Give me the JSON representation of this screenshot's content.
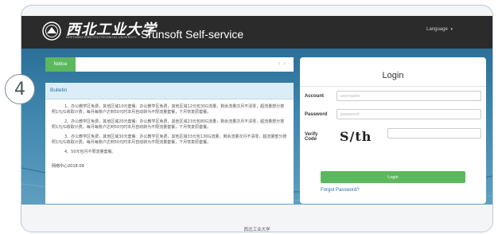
{
  "step_number": "4",
  "header": {
    "logo_cn": "西北工业大学",
    "logo_en": "NORTHWESTERN POLYTECHNICAL UNIVERSITY",
    "app_title": "Srunsoft Self-service",
    "language_label": "Language",
    "language_caret": "▾"
  },
  "notice": {
    "tab_label": "Notice",
    "nav_prev": "‹",
    "nav_next": "›"
  },
  "bulletin": {
    "title": "Bulletin",
    "items": [
      "1、办公教学区免费，其他区域10元套餐：办公教学区免费，其他区域12元包30G流量，剩余流量次月不清零，超流量部分按照1元/G收取计费。每月每账户达到50元时本月自动转为不限流量套餐，下月恢复原套餐。",
      "2、办公教学区免费，其他区域20元套餐：办公教学区免费，其他区域23元包80G流量，剩余流量次月不清零，超流量部分按照1元/G收取计费。每月每账户达到50元时本月自动转为不限流量套餐，下月恢复原套餐。",
      "3、办公教学区免费，其他区域30元套餐：办公教学区免费，其他区域33元包130G流量，剩余流量次月不清零，超流量部分按照1元/G收取计费。每月每账户达到50元时本月自动转为不限流量套餐，下月恢复原套餐。",
      "4、50元包月不限流量套餐。"
    ],
    "signature": "网络中心2018.09"
  },
  "login": {
    "title": "Login",
    "account_label": "Account",
    "account_placeholder": "username",
    "password_label": "Password",
    "password_placeholder": "password",
    "verify_label_line1": "Verify",
    "verify_label_line2": "Code",
    "captcha_text": "S/th",
    "login_button": "Login",
    "forgot_link": "Forgot Password?"
  },
  "footer": {
    "text": "西北工业大学"
  },
  "colors": {
    "header_bg": "#2b2b2b",
    "accent_green": "#5cb85c",
    "stage_blue": "#3e85ad",
    "bulletin_head_bg": "#dbeef7",
    "link_blue": "#2a6fa1"
  }
}
